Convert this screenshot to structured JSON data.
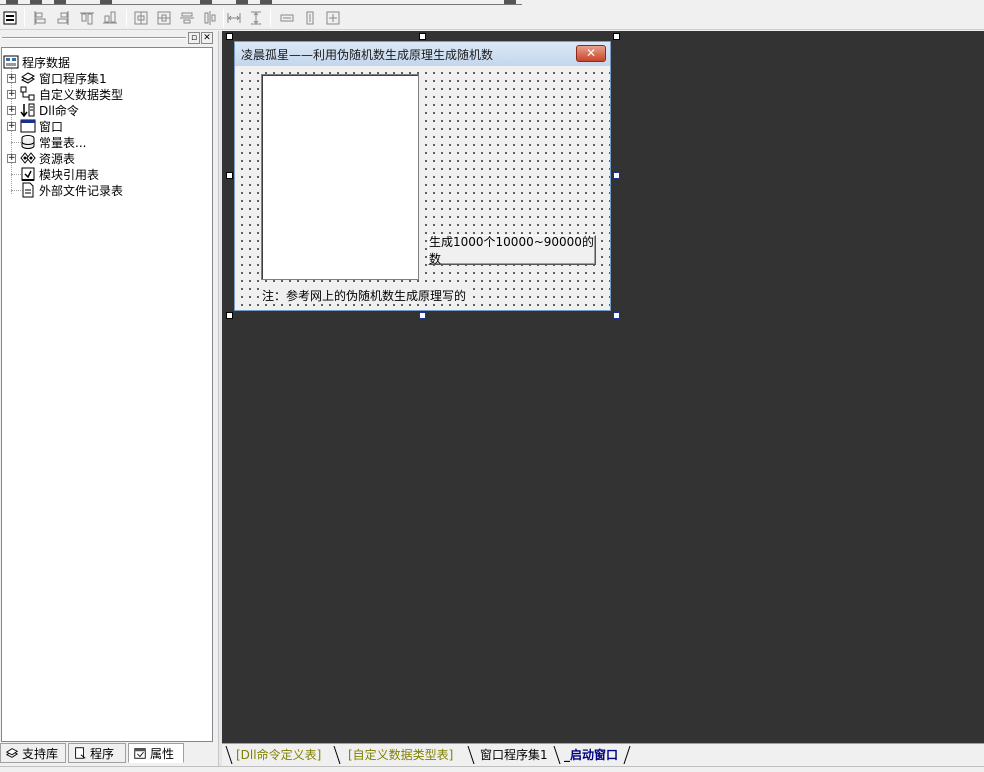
{
  "toolbar": {
    "icons": [
      "form-icon",
      "align-left-icon",
      "align-right-icon",
      "align-top-icon",
      "align-bottom-icon",
      "center-horizontal-icon",
      "center-vertical-icon",
      "align-h-center-icon",
      "align-v-center-icon",
      "space-horizontal-icon",
      "space-vertical-icon",
      "same-width-icon",
      "same-height-icon",
      "same-size-icon"
    ]
  },
  "left_panel": {
    "tree": {
      "root": "程序数据",
      "items": [
        {
          "label": "窗口程序集1",
          "icon": "books-icon",
          "expandable": true
        },
        {
          "label": "自定义数据类型",
          "icon": "type-icon",
          "expandable": true
        },
        {
          "label": "Dll命令",
          "icon": "dll-icon",
          "expandable": true
        },
        {
          "label": "窗口",
          "icon": "window-icon",
          "expandable": true
        },
        {
          "label": "常量表...",
          "icon": "constant-icon",
          "expandable": false
        },
        {
          "label": "资源表",
          "icon": "resource-icon",
          "expandable": true
        },
        {
          "label": "模块引用表",
          "icon": "module-icon",
          "expandable": false
        },
        {
          "label": "外部文件记录表",
          "icon": "file-record-icon",
          "expandable": false
        }
      ]
    },
    "tabs": [
      {
        "label": "支持库",
        "icon": "library-icon"
      },
      {
        "label": "程序",
        "icon": "program-icon"
      },
      {
        "label": "属性",
        "icon": "properties-icon"
      }
    ]
  },
  "design_window": {
    "title": "凌晨孤星——利用伪随机数生成原理生成随机数",
    "close_label": "✕",
    "button_label": "生成1000个10000~90000的数",
    "note_label": "注：参考网上的伪随机数生成原理写的"
  },
  "bottom_tabs": [
    {
      "label": "[Dll命令定义表]",
      "style": "olive"
    },
    {
      "label": "[自定义数据类型表]",
      "style": "olive"
    },
    {
      "label": "窗口程序集1",
      "style": "normal"
    },
    {
      "label": "_启动窗口",
      "style": "active"
    }
  ],
  "colors": {
    "workspace": "#333333",
    "olive_tab": "#808000",
    "active_tab": "#00007f"
  }
}
